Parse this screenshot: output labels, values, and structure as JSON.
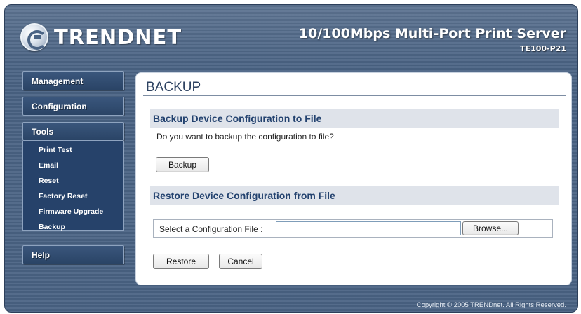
{
  "header": {
    "brand": "TRENDNET",
    "product_title": "10/100Mbps Multi-Port Print Server",
    "model": "TE100-P21"
  },
  "sidebar": {
    "management": "Management",
    "configuration": "Configuration",
    "tools": "Tools",
    "tools_items": [
      "Print Test",
      "Email",
      "Reset",
      "Factory Reset",
      "Firmware Upgrade",
      "Backup"
    ],
    "help": "Help"
  },
  "main": {
    "title": "BACKUP",
    "backup_section": "Backup Device Configuration to File",
    "backup_question": "Do you want to backup the configuration to file?",
    "backup_button": "Backup",
    "restore_section": "Restore Device Configuration from File",
    "file_label": "Select a Configuration File :",
    "file_value": "",
    "browse_button": "Browse...",
    "restore_button": "Restore",
    "cancel_button": "Cancel"
  },
  "footer": {
    "copyright": "Copyright © 2005 TRENDnet. All Rights Reserved."
  },
  "colors": {
    "frame": "#4a6384",
    "nav": "#2a4466",
    "section_bar": "#dfe3ea",
    "section_text": "#23426f"
  },
  "icons": {
    "logo": "trendnet-logo-icon"
  }
}
